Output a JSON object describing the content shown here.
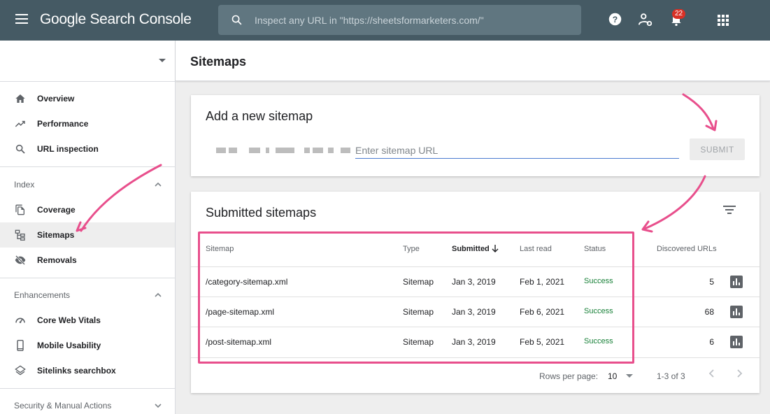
{
  "app": {
    "title": "Google Search Console",
    "search_placeholder": "Inspect any URL in \"https://sheetsformarketers.com/\"",
    "notification_count": "22",
    "icons": [
      "menu-icon",
      "search-icon",
      "help-icon",
      "account-settings-icon",
      "bell-icon",
      "apps-grid-icon"
    ]
  },
  "sidebar": {
    "top_items": [
      {
        "label": "Overview",
        "icon": "home-icon"
      },
      {
        "label": "Performance",
        "icon": "trending-up-icon"
      },
      {
        "label": "URL inspection",
        "icon": "search-icon"
      }
    ],
    "index": {
      "header": "Index",
      "items": [
        {
          "label": "Coverage",
          "icon": "copy-icon"
        },
        {
          "label": "Sitemaps",
          "icon": "sitemap-icon",
          "active": true
        },
        {
          "label": "Removals",
          "icon": "visibility-off-icon"
        }
      ]
    },
    "enhancements": {
      "header": "Enhancements",
      "items": [
        {
          "label": "Core Web Vitals",
          "icon": "speed-icon"
        },
        {
          "label": "Mobile Usability",
          "icon": "phone-icon"
        },
        {
          "label": "Sitelinks searchbox",
          "icon": "layers-icon"
        }
      ]
    },
    "security_header": "Security & Manual Actions"
  },
  "page": {
    "title": "Sitemaps"
  },
  "add_sitemap": {
    "title": "Add a new sitemap",
    "input_placeholder": "Enter sitemap URL",
    "submit_label": "SUBMIT"
  },
  "submitted": {
    "title": "Submitted sitemaps",
    "columns": {
      "sitemap": "Sitemap",
      "type": "Type",
      "submitted": "Submitted",
      "last_read": "Last read",
      "status": "Status",
      "discovered": "Discovered URLs"
    },
    "rows": [
      {
        "sitemap": "/category-sitemap.xml",
        "type": "Sitemap",
        "submitted": "Jan 3, 2019",
        "last_read": "Feb 1, 2021",
        "status": "Success",
        "discovered": "5"
      },
      {
        "sitemap": "/page-sitemap.xml",
        "type": "Sitemap",
        "submitted": "Jan 3, 2019",
        "last_read": "Feb 6, 2021",
        "status": "Success",
        "discovered": "68"
      },
      {
        "sitemap": "/post-sitemap.xml",
        "type": "Sitemap",
        "submitted": "Jan 3, 2019",
        "last_read": "Feb 5, 2021",
        "status": "Success",
        "discovered": "6"
      }
    ],
    "footer": {
      "rows_per_page_label": "Rows per page:",
      "rows_per_page_value": "10",
      "range": "1-3 of 3"
    }
  },
  "colors": {
    "header_bg": "#455a64",
    "accent_annotation": "#e84f8c",
    "success": "#188038",
    "badge": "#d93025"
  }
}
